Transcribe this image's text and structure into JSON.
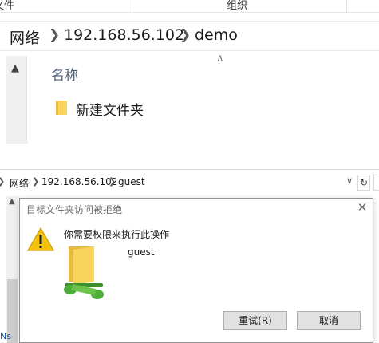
{
  "ribbon": {
    "left_text": "文件",
    "group_label": "组织"
  },
  "explorer_top": {
    "breadcrumb": [
      "网络",
      "192.168.56.102",
      "demo"
    ],
    "column_header": "名称",
    "items": [
      {
        "name": "新建文件夹",
        "icon": "folder-icon"
      }
    ]
  },
  "explorer_bottom": {
    "breadcrumb": [
      "网络",
      "192.168.56.102",
      "guest"
    ],
    "refresh_glyph": "↻"
  },
  "dialog": {
    "title": "目标文件夹访问被拒绝",
    "close_glyph": "✕",
    "message": "你需要权限来执行此操作",
    "item_name": "guest",
    "retry_label": "重试(R)",
    "cancel_label": "取消"
  },
  "colors": {
    "folder": "#f8d45f",
    "folder_dark": "#e7b946",
    "warning": "#f4c20d",
    "network_green": "#4caf3a",
    "column_header": "#4b5d77"
  },
  "left_edge_char": "Ns"
}
